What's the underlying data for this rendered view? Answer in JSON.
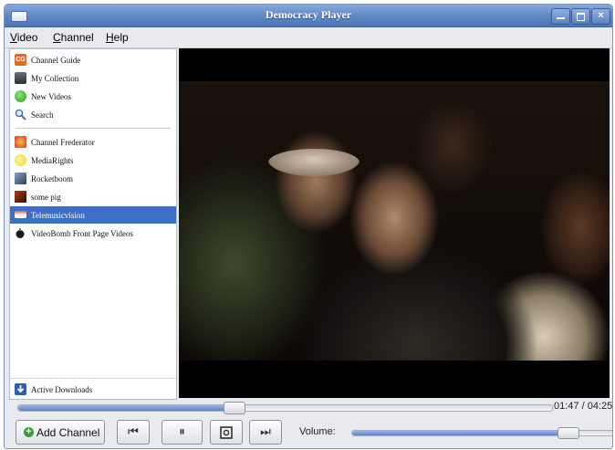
{
  "window": {
    "title": "Democracy Player"
  },
  "menu": {
    "items": [
      {
        "label": "Video",
        "mnemonic": "V",
        "rest": "ideo"
      },
      {
        "label": "Channel",
        "mnemonic": "C",
        "rest": "hannel"
      },
      {
        "label": "Help",
        "mnemonic": "H",
        "rest": "elp"
      }
    ]
  },
  "sidebar": {
    "static_items": [
      {
        "label": "Channel Guide",
        "icon": "channel-guide-icon"
      },
      {
        "label": "My Collection",
        "icon": "collection-icon"
      },
      {
        "label": "New Videos",
        "icon": "new-videos-icon"
      },
      {
        "label": "Search",
        "icon": "search-icon"
      }
    ],
    "channels": [
      {
        "label": "Channel Frederator",
        "icon": "frederator-icon"
      },
      {
        "label": "MediaRights",
        "icon": "mediarights-icon"
      },
      {
        "label": "Rocketboom",
        "icon": "rocketboom-icon"
      },
      {
        "label": "some pig",
        "icon": "some-pig-icon"
      },
      {
        "label": "Telemusicvision",
        "icon": "telemusicvision-icon",
        "selected": true
      },
      {
        "label": "VideoBomb Front Page Videos",
        "icon": "videobomb-icon"
      }
    ],
    "active_downloads": {
      "label": "Active Downloads",
      "icon": "downloads-icon"
    }
  },
  "playback": {
    "time_readout": "01:47 / 04:25",
    "progress_fraction": 0.404
  },
  "controls": {
    "add_channel": "Add Channel",
    "volume_label": "Volume:",
    "volume_fraction": 0.82
  },
  "colors": {
    "selection": "#3f6fc4",
    "title_bar": "#5f86c4"
  }
}
